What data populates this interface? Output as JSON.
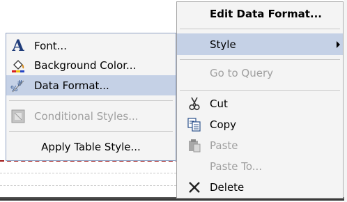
{
  "context_menu": {
    "items": [
      {
        "label": "Edit Data Format...",
        "bold": true,
        "enabled": true
      },
      {
        "label": "Style",
        "enabled": true,
        "highlighted": true,
        "has_submenu": true
      },
      {
        "label": "Go to Query",
        "enabled": false
      },
      {
        "label": "Cut",
        "icon": "scissors-icon",
        "enabled": true
      },
      {
        "label": "Copy",
        "icon": "copy-icon",
        "enabled": true
      },
      {
        "label": "Paste",
        "icon": "paste-icon",
        "enabled": false
      },
      {
        "label": "Paste To...",
        "enabled": false
      },
      {
        "label": "Delete",
        "icon": "delete-x-icon",
        "enabled": true
      }
    ]
  },
  "style_submenu": {
    "items": [
      {
        "label": "Font...",
        "icon": "font-icon",
        "enabled": true
      },
      {
        "label": "Background Color...",
        "icon": "paint-bucket-icon",
        "enabled": true
      },
      {
        "label": "Data Format...",
        "icon": "data-format-icon",
        "enabled": true,
        "highlighted": true
      },
      {
        "label": "Conditional Styles...",
        "icon": "conditional-styles-icon",
        "enabled": false
      },
      {
        "label": "Apply Table Style...",
        "enabled": true
      }
    ]
  },
  "colors": {
    "highlight": "#c5d1e6",
    "menu_background": "#f4f4f4",
    "disabled_text": "#9f9f9f",
    "divider_red": "#a01818"
  }
}
